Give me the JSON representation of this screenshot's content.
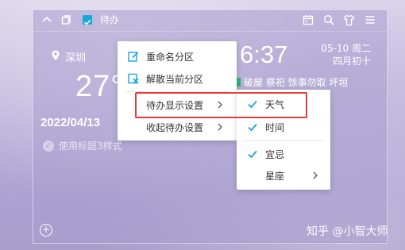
{
  "toolbar": {
    "title": "待办",
    "icons": [
      "chevron-up-icon",
      "copy-icon",
      "checkbox-icon",
      "calendar-icon",
      "search-icon",
      "shirt-icon",
      "menu-icon"
    ]
  },
  "weather": {
    "location": "深圳",
    "temperature": "27°",
    "date": "2022/04/13"
  },
  "style_toggle": {
    "label": "使用标题3样式"
  },
  "clock": {
    "time": "6:37",
    "date_line": "05-10 周二",
    "lunar_line": "四月初十"
  },
  "almanac": {
    "items": "破屋 祭祀 馀事勿取 坏垣"
  },
  "context_menu": {
    "items": [
      {
        "label": "重命名分区",
        "icon": "edit-icon",
        "has_submenu": false
      },
      {
        "label": "解散当前分区",
        "icon": "dissolve-icon",
        "has_submenu": false
      },
      {
        "label": "待办显示设置",
        "icon": "",
        "has_submenu": true
      },
      {
        "label": "收起待办设置",
        "icon": "",
        "has_submenu": true
      }
    ]
  },
  "submenu": {
    "items": [
      {
        "label": "天气",
        "checked": true,
        "has_submenu": false
      },
      {
        "label": "时间",
        "checked": true,
        "has_submenu": false
      },
      {
        "label": "宜忌",
        "checked": true,
        "has_submenu": false
      },
      {
        "label": "星座",
        "checked": false,
        "has_submenu": true
      }
    ]
  },
  "watermark": {
    "text": "知乎 @小智大师"
  },
  "colors": {
    "accent": "#19a8d8",
    "check": "#19a8d8",
    "highlight": "#e23c3c",
    "good_badge": "#2fb57a"
  }
}
